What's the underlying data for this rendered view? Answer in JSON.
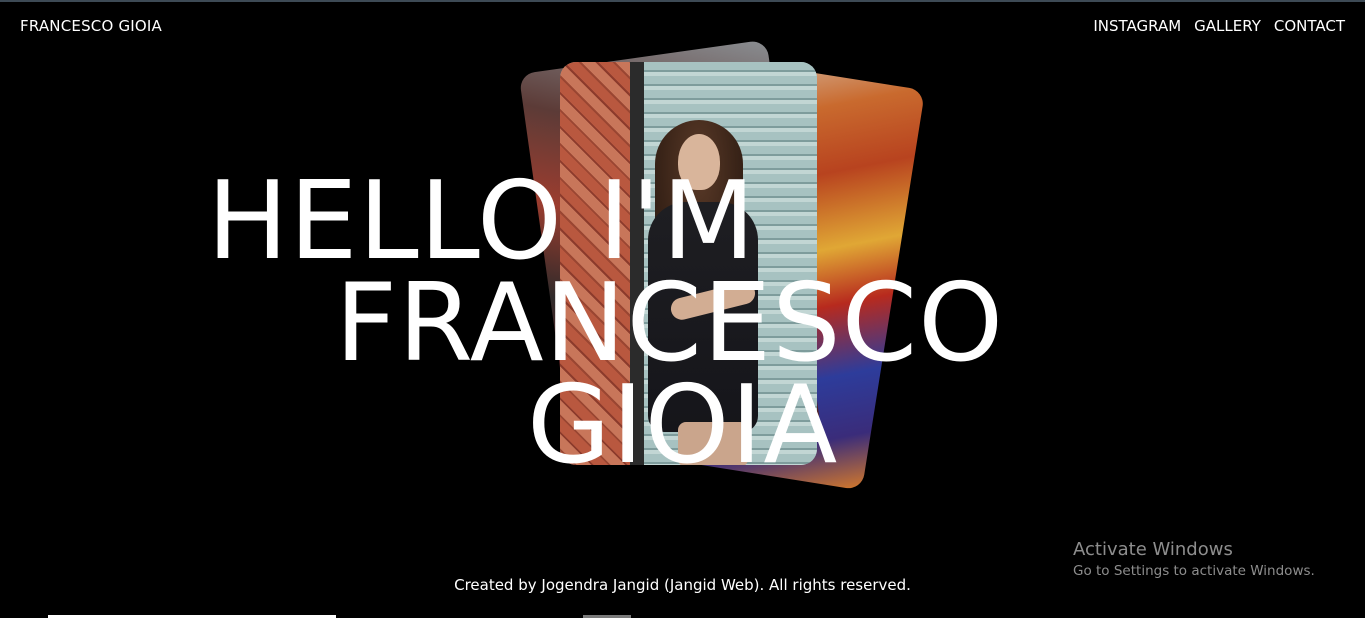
{
  "header": {
    "brand": "FRANCESCO GIOIA",
    "nav": [
      {
        "label": "INSTAGRAM"
      },
      {
        "label": "GALLERY"
      },
      {
        "label": "CONTACT"
      }
    ]
  },
  "hero": {
    "line1": "HELLO I'M",
    "line2": "FRANCESCO",
    "line3": "GIOIA"
  },
  "footer": {
    "credit": "Created by Jogendra Jangid (Jangid Web). All rights reserved."
  },
  "os_overlay": {
    "title": "Activate Windows",
    "subtitle": "Go to Settings to activate Windows."
  },
  "colors": {
    "background": "#000000",
    "text": "#ffffff",
    "overlay_text": "#8d8d8d"
  }
}
